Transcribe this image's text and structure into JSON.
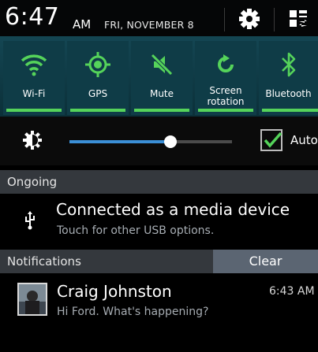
{
  "status": {
    "time": "6:47",
    "ampm": "AM",
    "date": "FRI, NOVEMBER 8",
    "settings_icon": "gear-icon",
    "toggle_panel_icon": "panel-switch-icon"
  },
  "quick_settings": [
    {
      "label": "Wi-Fi",
      "icon": "wifi-icon",
      "on": true
    },
    {
      "label": "GPS",
      "icon": "gps-icon",
      "on": true
    },
    {
      "label": "Mute",
      "icon": "mute-icon",
      "on": true
    },
    {
      "label": "Screen rotation",
      "icon": "rotation-icon",
      "on": true
    },
    {
      "label": "Bluetooth",
      "icon": "bluetooth-icon",
      "on": true
    }
  ],
  "brightness": {
    "icon": "brightness-icon",
    "level": 0.62,
    "auto_checked": true,
    "auto_label": "Auto"
  },
  "ongoing": {
    "header": "Ongoing",
    "item": {
      "icon": "usb-icon",
      "title": "Connected as a media device",
      "subtitle": "Touch for other USB options."
    }
  },
  "notifications": {
    "header": "Notifications",
    "clear_label": "Clear",
    "items": [
      {
        "avatar": "contact-photo",
        "title": "Craig Johnston",
        "message": "Hi Ford. What's happening?",
        "time": "6:43 AM"
      }
    ]
  },
  "colors": {
    "accent_green": "#55d35a",
    "slider_blue": "#3b8fd6",
    "toggle_bg": "#0f3c47"
  }
}
